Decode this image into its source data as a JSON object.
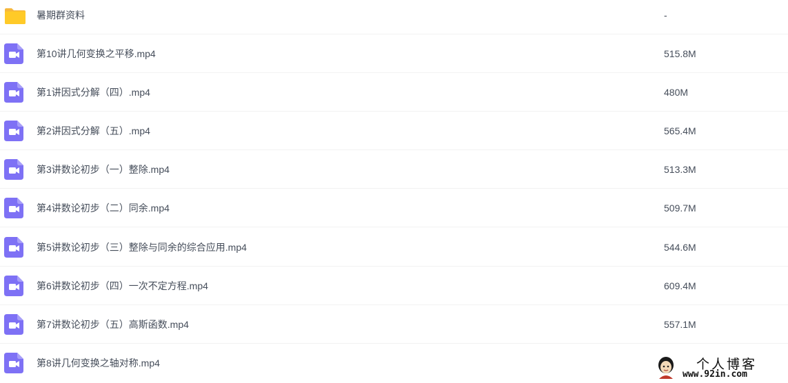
{
  "colors": {
    "folder_icon": "#FFCA28",
    "video_icon": "#7E71F5",
    "text": "#454d5a",
    "divider": "#f2f2f2"
  },
  "files": [
    {
      "name": "暑期群资料",
      "size": "-",
      "icon": "folder-icon"
    },
    {
      "name": "第10讲几何变换之平移.mp4",
      "size": "515.8M",
      "icon": "video-file-icon"
    },
    {
      "name": "第1讲因式分解（四）.mp4",
      "size": "480M",
      "icon": "video-file-icon"
    },
    {
      "name": "第2讲因式分解（五）.mp4",
      "size": "565.4M",
      "icon": "video-file-icon"
    },
    {
      "name": "第3讲数论初步（一）整除.mp4",
      "size": "513.3M",
      "icon": "video-file-icon"
    },
    {
      "name": "第4讲数论初步（二）同余.mp4",
      "size": "509.7M",
      "icon": "video-file-icon"
    },
    {
      "name": "第5讲数论初步（三）整除与同余的综合应用.mp4",
      "size": "544.6M",
      "icon": "video-file-icon"
    },
    {
      "name": "第6讲数论初步（四）一次不定方程.mp4",
      "size": "609.4M",
      "icon": "video-file-icon"
    },
    {
      "name": "第7讲数论初步（五）高斯函数.mp4",
      "size": "557.1M",
      "icon": "video-file-icon"
    },
    {
      "name": "第8讲几何变换之轴对称.mp4",
      "size": "",
      "icon": "video-file-icon"
    }
  ],
  "watermark": {
    "title": "个人博客",
    "url": "www.92in.com"
  }
}
